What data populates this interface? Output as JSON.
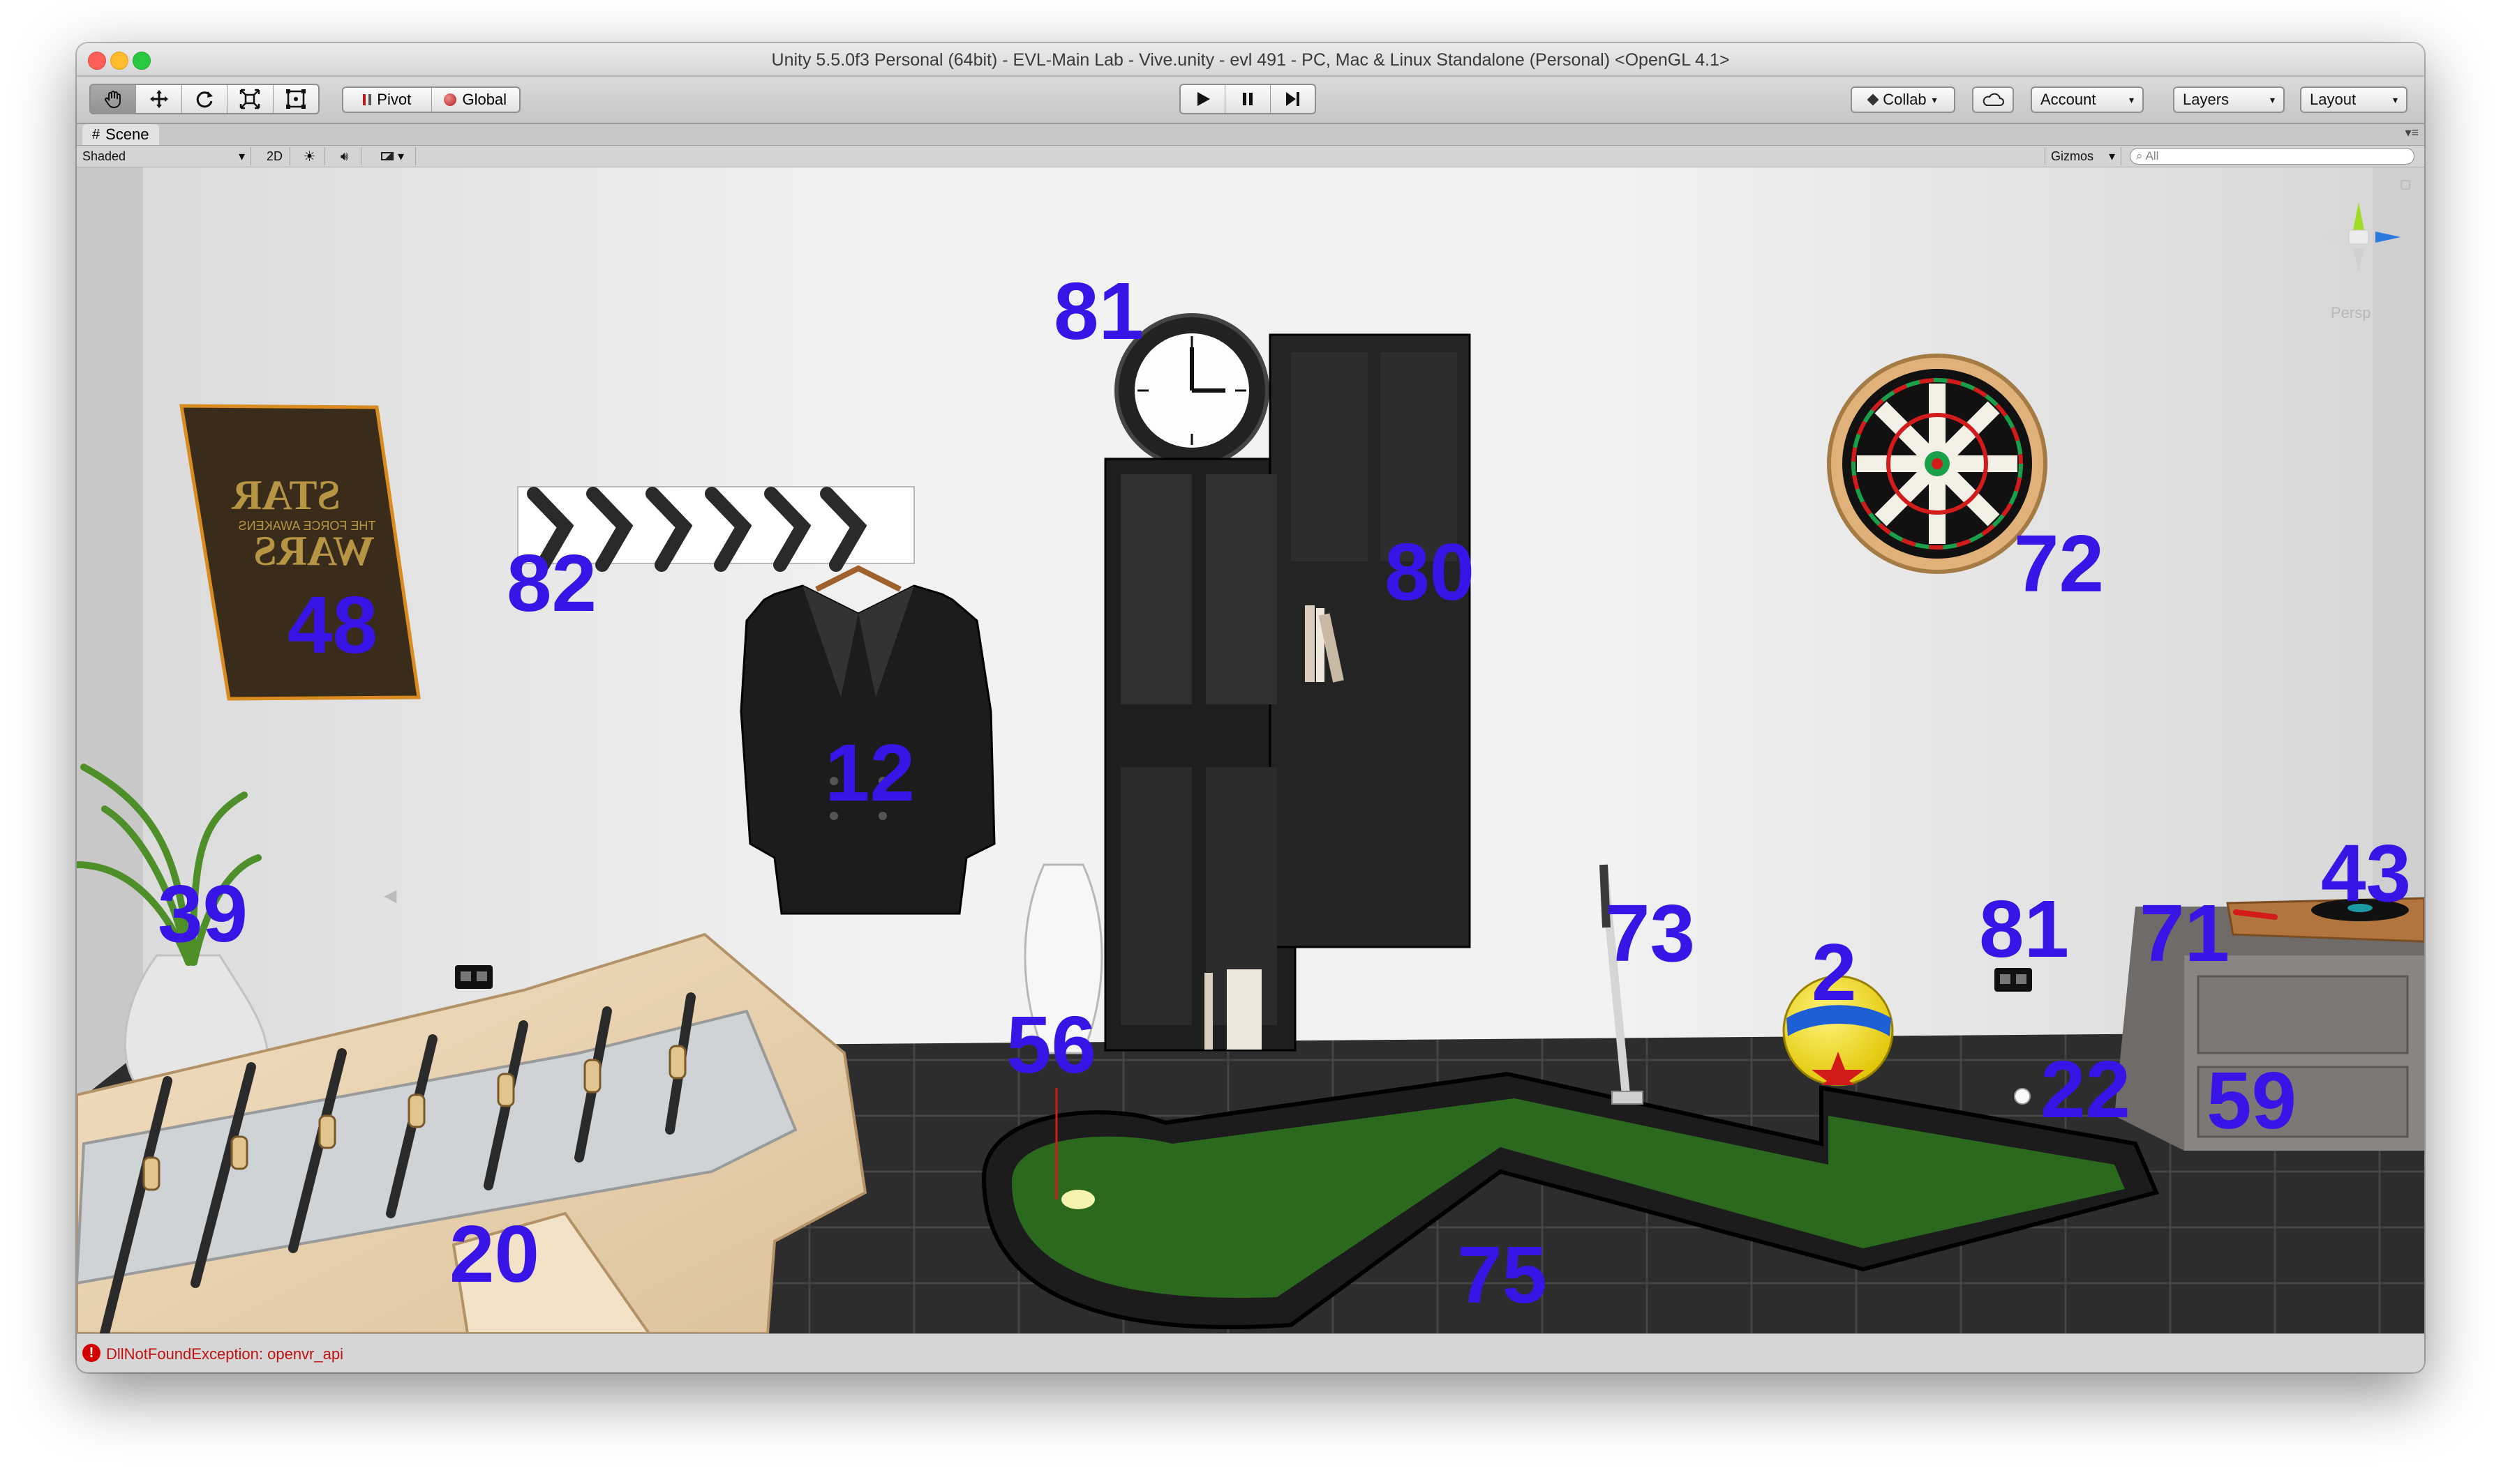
{
  "window": {
    "title": "Unity 5.5.0f3 Personal (64bit) - EVL-Main Lab - Vive.unity - evl 491 - PC, Mac & Linux Standalone (Personal) <OpenGL 4.1>"
  },
  "toolbar": {
    "tools": [
      "hand-tool",
      "move-tool",
      "rotate-tool",
      "scale-tool",
      "rect-tool"
    ],
    "pivot_label": "Pivot",
    "global_label": "Global",
    "collab_label": "Collab",
    "account_label": "Account",
    "layers_label": "Layers",
    "layout_label": "Layout"
  },
  "scene_tab": {
    "label": "Scene"
  },
  "scene_toolbar": {
    "shading_mode": "Shaded",
    "mode_2d_label": "2D",
    "gizmos_label": "Gizmos",
    "search_placeholder": "All"
  },
  "gizmo": {
    "projection_label": "Persp"
  },
  "poster": {
    "title_line1": "STAR",
    "subtitle": "THE FORCE AWAKENS",
    "title_line2": "WARS"
  },
  "object_labels": {
    "clock": "81",
    "bookcase": "80",
    "dartboard": "72",
    "coat_rack": "82",
    "poster": "48",
    "coat": "12",
    "plant": "39",
    "vase": "56",
    "putter": "73",
    "ball": "2",
    "outlet": "81",
    "turntable_arm": "71",
    "turntable": "43",
    "golf_ball": "22",
    "cabinet": "59",
    "foosball": "20",
    "putting_green": "75"
  },
  "status": {
    "message": "DllNotFoundException: openvr_api"
  },
  "colors": {
    "label": "#3914e6",
    "green": "#2b6a1e",
    "error": "#d40000"
  }
}
